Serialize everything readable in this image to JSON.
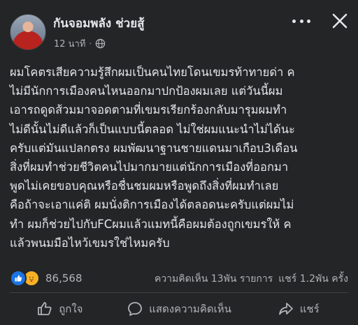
{
  "post": {
    "author": "กันจอมพลัง ช่วยสู้",
    "time": "12 นาที",
    "separator": "·",
    "privacy_icon": "globe-icon",
    "body_lines": [
      "ผมโคตรเสียความรู้สึกผมเป็นคนไทยโดนเขมรท้าทายด่า ค",
      "ไม่มีนักการเมืองคนไหนออกมาปกป้องผมเลย แต่วันนี้ผม",
      "เอารถดูดส้วมมาจอดตามที่เขมรเรียกร้องกลับมารุมผมทำ",
      "ไม่ดีนั้นไม่ดีแล้วก็เป็นแบบนี้ตลอด ไม่ใช่ผมแนะนำไม่ได้นะ",
      "ครับแต่มันแปลกตรง ผมพัฒนาฐานชายแดนมาเกือบ3เดือน",
      "สิ่งที่ผมทำช่วยชีวิตคนไปมากมายแต่นักการเมืองที่ออกมา",
      "พูดไม่เคยขอบคุณหรือชื่นชมผมหรือพูดถึงสิ่งที่ผมทำเลย",
      "คือถ้าจะเอาแค่ติ ผมนั่งติการเมืองได้ตลอดนะครับแต่ผมไม่",
      "ทำ ผมก็ช่วยไปกับFCผมแล้วแมทนี้คือผมต้องถูกเขมรให้ ค",
      "แล้วพนมมือไหว้เขมรใช่ไหมครับ"
    ]
  },
  "reactions": {
    "count": "86,568",
    "icons": [
      "like-icon",
      "care-icon"
    ]
  },
  "stats": {
    "comments": "ความคิดเห็น 13พัน รายการ",
    "shares": "แชร์ 1.2พัน ครั้ง"
  },
  "actions": {
    "like_label": "ถูกใจ",
    "comment_label": "แสดงความคิดเห็น",
    "share_label": "แชร์"
  },
  "colors": {
    "background": "#242526",
    "text": "#e4e6eb",
    "secondary_text": "#b0b3b8",
    "like_blue": "#1b74e4"
  }
}
